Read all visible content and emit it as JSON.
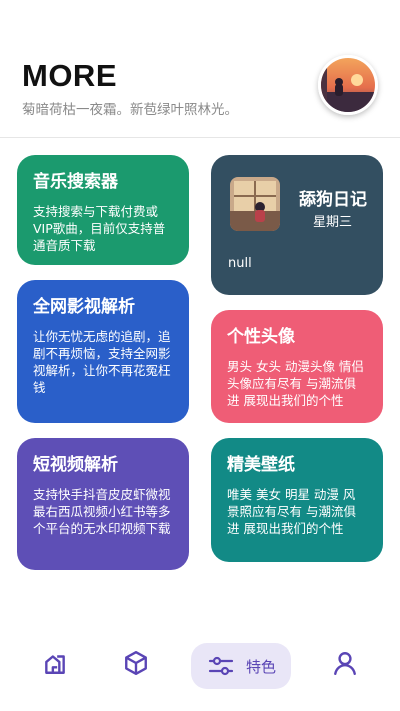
{
  "header": {
    "title": "MORE",
    "subtitle": "菊暗荷枯一夜霜。新苞绿叶照林光。"
  },
  "cards": {
    "music": {
      "title": "音乐搜索器",
      "desc": "支持搜索与下载付费或VIP歌曲，目前仅支持普通音质下载",
      "color": "#1b9a6e"
    },
    "video": {
      "title": "全网影视解析",
      "desc": "让你无忧无虑的追剧，追剧不再烦恼，支持全网影视解析，让你不再花冤枉钱",
      "color": "#2a5fc9"
    },
    "short": {
      "title": "短视频解析",
      "desc": "支持快手抖音皮皮虾微视最右西瓜视频小红书等多个平台的无水印视频下载",
      "color": "#5e4fb6"
    },
    "diary": {
      "title": "舔狗日记",
      "weekday": "星期三",
      "content": "null",
      "color": "#334f61"
    },
    "head": {
      "title": "个性头像",
      "desc": "男头 女头 动漫头像 情侣头像应有尽有 与潮流俱进 展现出我们的个性",
      "color": "#ef5d76"
    },
    "wall": {
      "title": "精美壁纸",
      "desc": "唯美 美女 明星 动漫 风景照应有尽有 与潮流俱进 展现出我们的个性",
      "color": "#128a86"
    }
  },
  "nav": {
    "active_label": "特色",
    "accent": "#5a45b5",
    "items": [
      "home-icon",
      "cube-icon",
      "sliders-icon",
      "user-icon"
    ]
  }
}
